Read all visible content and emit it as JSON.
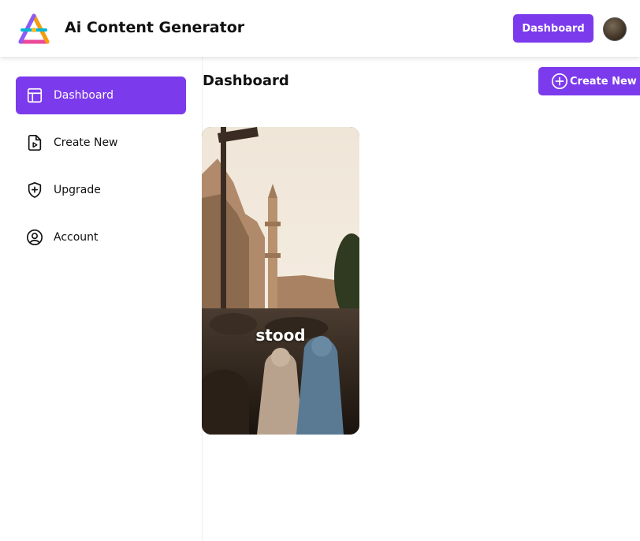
{
  "header": {
    "app_title": "Ai Content Generator",
    "dashboard_button": "Dashboard",
    "logo_icon": "triangle-logo-icon",
    "avatar": "user-avatar"
  },
  "sidebar": {
    "items": [
      {
        "label": "Dashboard",
        "icon": "layout-icon",
        "active": true
      },
      {
        "label": "Create New",
        "icon": "file-video-icon",
        "active": false
      },
      {
        "label": "Upgrade",
        "icon": "shield-plus-icon",
        "active": false
      },
      {
        "label": "Account",
        "icon": "user-circle-icon",
        "active": false
      }
    ]
  },
  "main": {
    "title": "Dashboard",
    "create_button": "Create New",
    "videos": [
      {
        "caption": "stood"
      }
    ]
  },
  "colors": {
    "accent": "#7c3aed",
    "background": "#ffffff"
  }
}
